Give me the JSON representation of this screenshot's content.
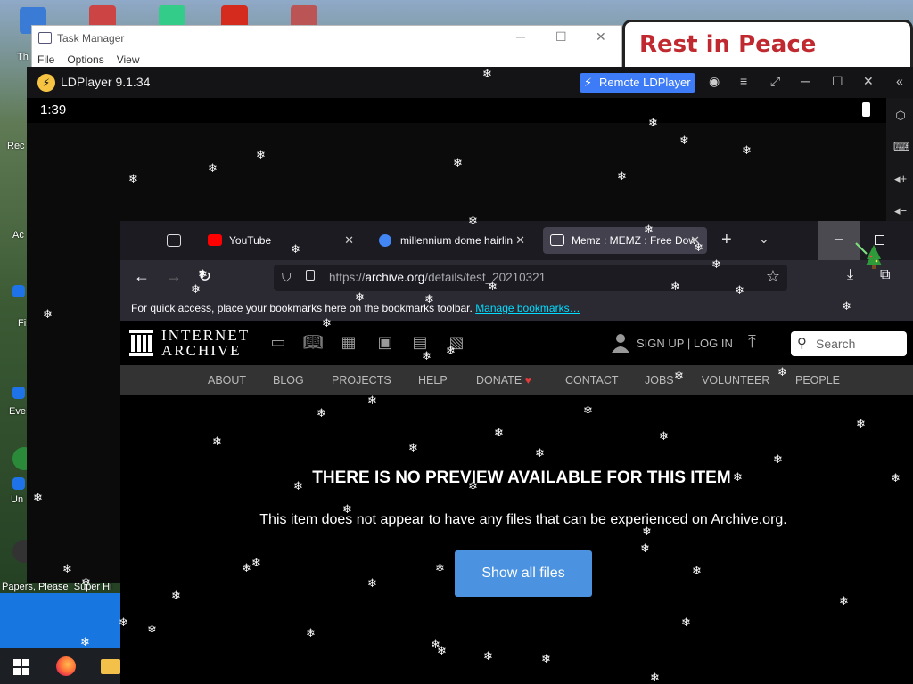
{
  "desktop": {
    "icon_labels": [
      "Th",
      "Rec",
      "Ac",
      "Fi",
      "Eve",
      "Un"
    ],
    "papers_label": "Papers, Please",
    "super_label": "Super Hi"
  },
  "task_manager": {
    "title": "Task Manager",
    "menu": [
      "File",
      "Options",
      "View"
    ]
  },
  "rip_window": {
    "text": "Rest in Peace"
  },
  "ldplayer": {
    "title": "LDPlayer 9.1.34",
    "remote_button": "Remote LDPlayer",
    "time": "1:39"
  },
  "firefox": {
    "tabs": [
      {
        "label": "YouTube",
        "favicon_color": "#ff0000",
        "active": false
      },
      {
        "label": "millennium dome hairlin",
        "favicon_color": "#4285f4",
        "active": false
      },
      {
        "label": "Memz : MEMZ : Free Dow",
        "favicon_color": "#ffffff",
        "active": true
      }
    ],
    "url_prefix": "https://",
    "url_domain": "archive.org",
    "url_path": "/details/test_20210321",
    "bookmarks_text": "For quick access, place your bookmarks here on the bookmarks toolbar. ",
    "bookmarks_link": "Manage bookmarks…"
  },
  "archive": {
    "logo_line1": "INTERNET",
    "logo_line2": "ARCHIVE",
    "media_icons": [
      "web-icon",
      "texts-icon",
      "video-icon",
      "audio-icon",
      "software-icon",
      "images-icon"
    ],
    "signup": "SIGN UP | LOG IN",
    "search_placeholder": "Search",
    "nav": [
      "ABOUT",
      "BLOG",
      "PROJECTS",
      "HELP",
      "DONATE",
      "CONTACT",
      "JOBS",
      "VOLUNTEER",
      "PEOPLE"
    ],
    "heading": "THERE IS NO PREVIEW AVAILABLE FOR THIS ITEM",
    "description": "This item does not appear to have any files that can be experienced on Archive.org.",
    "button": "Show all files"
  },
  "colors": {
    "accent_blue": "#4b92e1",
    "ld_remote_blue": "#3d7bf7",
    "rip_red": "#c0292f",
    "link_cyan": "#00ddff"
  }
}
